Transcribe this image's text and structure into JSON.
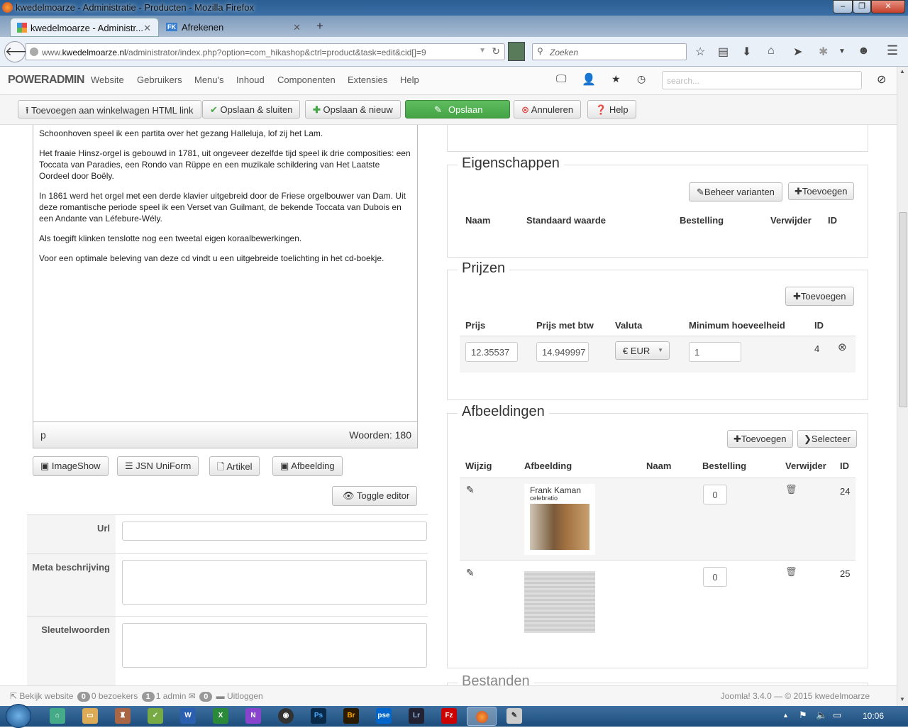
{
  "window": {
    "title": "kwedelmoarze - Administratie - Producten - Mozilla Firefox"
  },
  "tabs": [
    {
      "label": "kwedelmoarze - Administr..."
    },
    {
      "label": "Afrekenen",
      "badge": "FK"
    }
  ],
  "browser": {
    "url_prefix": "www.",
    "url_domain": "kwedelmoarze.nl",
    "url_path": "/administrator/index.php?option=com_hikashop&ctrl=product&task=edit&cid[]=9",
    "search_placeholder": "Zoeken"
  },
  "admin_nav": {
    "brand": "POWERADMIN",
    "items": [
      "Website",
      "Gebruikers",
      "Menu's",
      "Inhoud",
      "Componenten",
      "Extensies",
      "Help"
    ],
    "search_placeholder": "search..."
  },
  "toolbar": {
    "add_cart_link": "Toevoegen aan winkelwagen HTML link",
    "save_close": "Opslaan & sluiten",
    "save_new": "Opslaan & nieuw",
    "save": "Opslaan",
    "cancel": "Annuleren",
    "help": "Help"
  },
  "editor": {
    "paragraphs": [
      "Schoonhoven speel ik een partita over het gezang Halleluja, lof zij het Lam.",
      "Het fraaie Hinsz-orgel is gebouwd in 1781, uit ongeveer dezelfde tijd speel ik drie composities: een Toccata van Paradies, een Rondo van Rüppe en een muzikale schildering van Het Laatste Oordeel door Boëly.",
      "In 1861 werd het orgel met een derde klavier uitgebreid door de Friese orgelbouwer van Dam. Uit deze romantische periode speel ik een Verset van Guilmant, de bekende Toccata van Dubois en een Andante van Léfebure-Wély.",
      "Als toegift klinken tenslotte nog een tweetal eigen koraalbewerkingen.",
      "Voor een optimale beleving van deze cd vindt u een uitgebreide toelichting in het cd-boekje."
    ],
    "path": "p",
    "word_count": "Woorden: 180",
    "buttons": [
      "ImageShow",
      "JSN UniForm",
      "Artikel",
      "Afbeelding"
    ],
    "toggle": "Toggle editor"
  },
  "form": {
    "url_label": "Url",
    "url_value": "",
    "meta_label": "Meta beschrijving",
    "keywords_label": "Sleutelwoorden"
  },
  "eigenschappen": {
    "title": "Eigenschappen",
    "manage_variants": "Beheer varianten",
    "add": "Toevoegen",
    "columns": [
      "Naam",
      "Standaard waarde",
      "Bestelling",
      "Verwijder",
      "ID"
    ]
  },
  "prijzen": {
    "title": "Prijzen",
    "add": "Toevoegen",
    "columns": [
      "Prijs",
      "Prijs met btw",
      "Valuta",
      "Minimum hoeveelheid",
      "ID"
    ],
    "rows": [
      {
        "price": "12.35537",
        "price_vat": "14.949997",
        "currency": "€ EUR",
        "min_qty": "1",
        "id": "4"
      }
    ]
  },
  "afbeeldingen": {
    "title": "Afbeeldingen",
    "add": "Toevoegen",
    "select": "Selecteer",
    "columns": [
      "Wijzig",
      "Afbeelding",
      "Naam",
      "Bestelling",
      "Verwijder",
      "ID"
    ],
    "rows": [
      {
        "order": "0",
        "id": "24",
        "cover_artist": "Frank Kaman",
        "cover_title": "celebratio"
      },
      {
        "order": "0",
        "id": "25"
      }
    ]
  },
  "bestanden": {
    "title": "Bestanden"
  },
  "footer": {
    "view_site": "Bekijk website",
    "visitors_count": "0",
    "visitors": "0 bezoekers",
    "admin_count": "1",
    "admin": "1 admin",
    "messages_count": "0",
    "logout": "Uitloggen",
    "version": "Joomla! 3.4.0 — © 2015 kwedelmoarze"
  },
  "taskbar": {
    "clock": "10:06"
  }
}
